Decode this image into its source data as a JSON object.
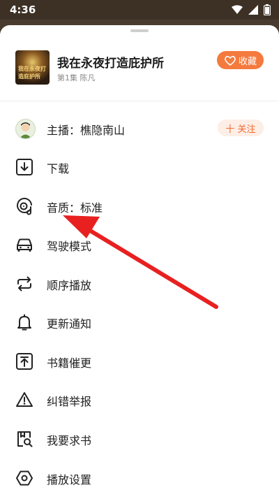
{
  "status_bar": {
    "time": "4:36"
  },
  "book": {
    "cover_text": "我在永夜打造庇护所",
    "title": "我在永夜打造庇护所",
    "meta": "第1集 陈凡",
    "favorite_label": "收藏"
  },
  "menu": {
    "host_label": "主播：樵隐南山",
    "follow_label": "十 关注",
    "items": [
      {
        "label": "下载",
        "icon": "download-icon"
      },
      {
        "label": "音质：标准",
        "icon": "sound-quality-icon"
      },
      {
        "label": "驾驶模式",
        "icon": "car-icon"
      },
      {
        "label": "顺序播放",
        "icon": "repeat-icon"
      },
      {
        "label": "更新通知",
        "icon": "bell-icon"
      },
      {
        "label": "书籍催更",
        "icon": "upload-box-icon"
      },
      {
        "label": "纠错举报",
        "icon": "warning-icon"
      },
      {
        "label": "我要求书",
        "icon": "book-search-icon"
      },
      {
        "label": "播放设置",
        "icon": "settings-hexagon-icon"
      }
    ]
  },
  "colors": {
    "accent": "#f47a3e",
    "arrow": "#e82020"
  }
}
